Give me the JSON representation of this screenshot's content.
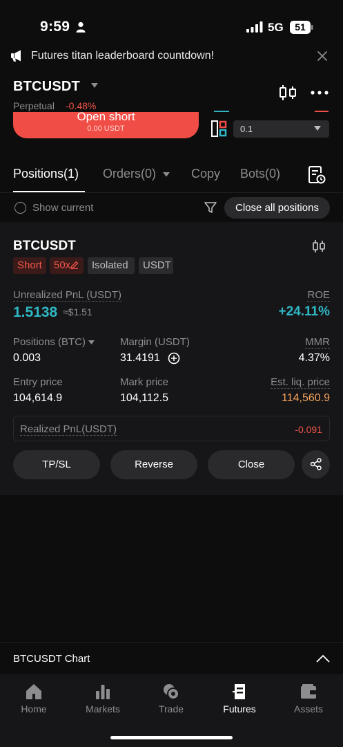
{
  "status_bar": {
    "time": "9:59",
    "network": "5G",
    "battery": "51"
  },
  "announcement": {
    "text": "Futures titan leaderboard countdown!"
  },
  "header": {
    "symbol": "BTCUSDT",
    "contract_type": "Perpetual",
    "change": "-0.48%"
  },
  "trade_form": {
    "open_short_label": "Open short",
    "open_short_amount": "0.00 USDT",
    "quantity_value": "0.1"
  },
  "tabs": [
    {
      "label": "Positions(1)",
      "active": true
    },
    {
      "label": "Orders(0)",
      "active": false
    },
    {
      "label": "Copy",
      "active": false
    },
    {
      "label": "Bots(0)",
      "active": false
    }
  ],
  "filter": {
    "show_current_label": "Show current",
    "close_all_label": "Close all positions"
  },
  "position": {
    "symbol": "BTCUSDT",
    "side": "Short",
    "leverage": "50x",
    "margin_mode": "Isolated",
    "settle_currency": "USDT",
    "unrealized_pnl_label": "Unrealized PnL (USDT)",
    "unrealized_pnl": "1.5138",
    "unrealized_pnl_approx": "≈$1.51",
    "roe_label": "ROE",
    "roe": "+24.11%",
    "positions_label": "Positions (BTC)",
    "positions": "0.003",
    "margin_label": "Margin (USDT)",
    "margin": "31.4191",
    "mmr_label": "MMR",
    "mmr": "4.37%",
    "entry_price_label": "Entry price",
    "entry_price": "104,614.9",
    "mark_price_label": "Mark price",
    "mark_price": "104,112.5",
    "liq_price_label": "Est. liq. price",
    "liq_price": "114,560.9",
    "realized_pnl_label": "Realized PnL(USDT)",
    "realized_pnl": "-0.091",
    "actions": {
      "tpsl": "TP/SL",
      "reverse": "Reverse",
      "close": "Close"
    }
  },
  "chart_bar": {
    "label": "BTCUSDT  Chart"
  },
  "bottom_nav": [
    {
      "label": "Home",
      "icon": "home-icon",
      "active": false
    },
    {
      "label": "Markets",
      "icon": "markets-icon",
      "active": false
    },
    {
      "label": "Trade",
      "icon": "trade-icon",
      "active": false
    },
    {
      "label": "Futures",
      "icon": "futures-icon",
      "active": true
    },
    {
      "label": "Assets",
      "icon": "assets-icon",
      "active": false
    }
  ],
  "colors": {
    "background": "#0d0d0e",
    "card": "#161618",
    "profit": "#2fb8c6",
    "loss": "#f2544a",
    "liquidation": "#f7a35c",
    "button": "#2a2a2d"
  }
}
